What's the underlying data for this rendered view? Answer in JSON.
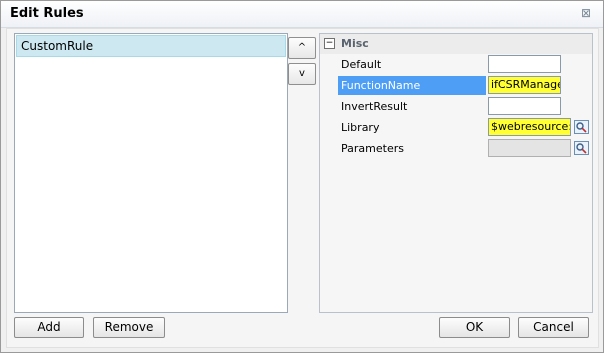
{
  "dialog": {
    "title": "Edit Rules",
    "close_glyph": "⊠"
  },
  "rules": {
    "items": [
      {
        "label": "CustomRule"
      }
    ]
  },
  "move_buttons": {
    "up_label": "^",
    "down_label": "v"
  },
  "properties": {
    "category": "Misc",
    "toggle_glyph": "−",
    "rows": [
      {
        "name": "Default",
        "value": ""
      },
      {
        "name": "FunctionName",
        "value": "ifCSRManager"
      },
      {
        "name": "InvertResult",
        "value": ""
      },
      {
        "name": "Library",
        "value": "$webresource:ne"
      },
      {
        "name": "Parameters",
        "value": ""
      }
    ]
  },
  "footer": {
    "add_label": "Add",
    "remove_label": "Remove",
    "ok_label": "OK",
    "cancel_label": "Cancel"
  },
  "colors": {
    "selected_rule": "#cde8f0",
    "selected_property": "#4d9ef4",
    "highlight": "#ffff33"
  }
}
